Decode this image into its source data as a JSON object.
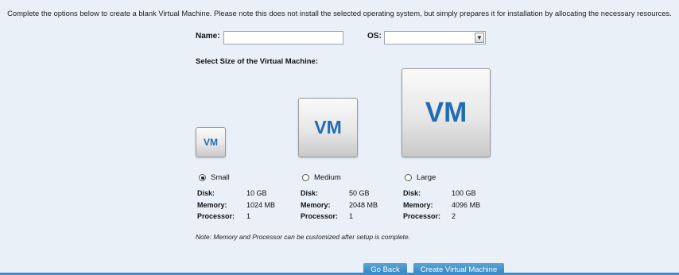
{
  "intro": {
    "text": "Complete the options below to create a blank Virtual Machine. Please note this does not install the selected operating system, but simply prepares it for installation by allocating the necessary resources."
  },
  "form": {
    "name_label": "Name:",
    "name_value": "",
    "os_label": "OS:",
    "os_selected": "",
    "os_arrow_icon": "chevron-down-icon"
  },
  "size_section": {
    "title": "Select Size of the Virtual Machine:",
    "disk_label": "Disk:",
    "memory_label": "Memory:",
    "processor_label": "Processor:",
    "options": [
      {
        "icon_text": "VM",
        "label": "Small",
        "selected": true,
        "disk": "10 GB",
        "memory": "1024 MB",
        "processor": "1"
      },
      {
        "icon_text": "VM",
        "label": "Medium",
        "selected": false,
        "disk": "50 GB",
        "memory": "2048 MB",
        "processor": "1"
      },
      {
        "icon_text": "VM",
        "label": "Large",
        "selected": false,
        "disk": "100 GB",
        "memory": "4096 MB",
        "processor": "2"
      }
    ]
  },
  "note": "Note: Memory and Processor can be customized after setup is complete.",
  "buttons": {
    "back": "Go Back",
    "create": "Create Virtual Machine"
  },
  "colors": {
    "background": "#e9f0f8",
    "vm_text": "#1f6db4",
    "button": "#2f7fbf"
  }
}
